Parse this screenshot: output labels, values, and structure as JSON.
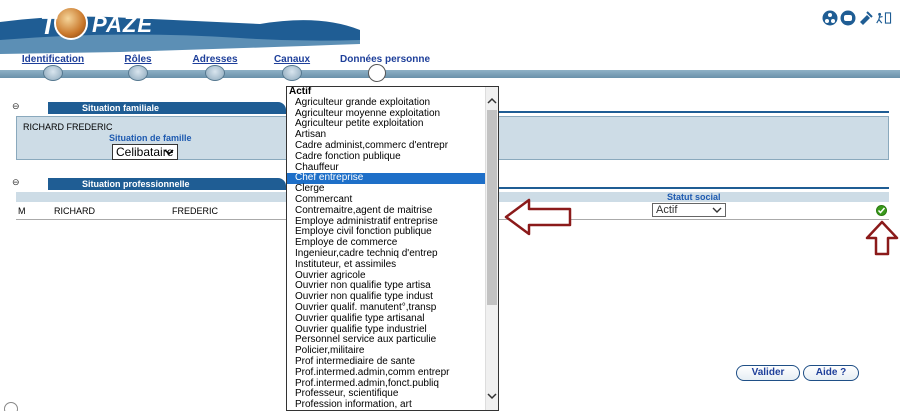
{
  "app": {
    "logo_prefix": "T",
    "logo_suffix": "PAZE"
  },
  "header_icons": [
    "network-icon",
    "phone-icon",
    "tools-icon",
    "exit-icon"
  ],
  "steps": [
    {
      "label": "Identification",
      "current": false
    },
    {
      "label": "Rôles",
      "current": false
    },
    {
      "label": "Adresses",
      "current": false
    },
    {
      "label": "Canaux",
      "current": false
    },
    {
      "label": "Données personne",
      "current": true
    }
  ],
  "situation_familiale": {
    "title": "Situation familiale",
    "toggle": "⊖",
    "name": "RICHARD  FREDERIC",
    "field_label": "Situation de famille",
    "value": "Celibataire"
  },
  "situation_professionnelle": {
    "title": "Situation professionnelle",
    "toggle": "⊖",
    "column_statut": "Statut social",
    "row": {
      "civilite": "M",
      "nom": "RICHARD",
      "prenom": "FREDERIC",
      "statut": "Actif"
    }
  },
  "dropdown": {
    "group": "Actif",
    "selected": "Chef entreprise",
    "options": [
      "Agriculteur grande exploitation",
      "Agriculteur moyenne exploitation",
      "Agriculteur petite exploitation",
      "Artisan",
      "Cadre administ,commerc d'entrepr",
      "Cadre fonction publique",
      "Chauffeur",
      "Chef entreprise",
      "Clerge",
      "Commercant",
      "Contremaitre,agent de maitrise",
      "Employe administratif entreprise",
      "Employe civil fonction publique",
      "Employe de commerce",
      "Ingenieur,cadre techniq d'entrep",
      "Instituteur, et assimiles",
      "Ouvrier agricole",
      "Ouvrier non qualifie type artisa",
      "Ouvrier non qualifie type indust",
      "Ouvrier qualif. manutent°,transp",
      "Ouvrier qualifie type artisanal",
      "Ouvrier qualifie type industriel",
      "Personnel service aux particulie",
      "Policier,militaire",
      "Prof intermediaire de sante",
      "Prof.intermed.admin,comm entrepr",
      "Prof.intermed.admin,fonct.publiq",
      "Professeur, scientifique",
      "Profession information, art"
    ]
  },
  "buttons": {
    "valider": "Valider",
    "aide": "Aide ?"
  },
  "colors": {
    "brand_blue": "#1f5d94",
    "panel_bg": "#cddce6",
    "selection": "#1e6fc8",
    "annotation_red": "#8b1a1a",
    "check_green": "#3a9b1c"
  }
}
